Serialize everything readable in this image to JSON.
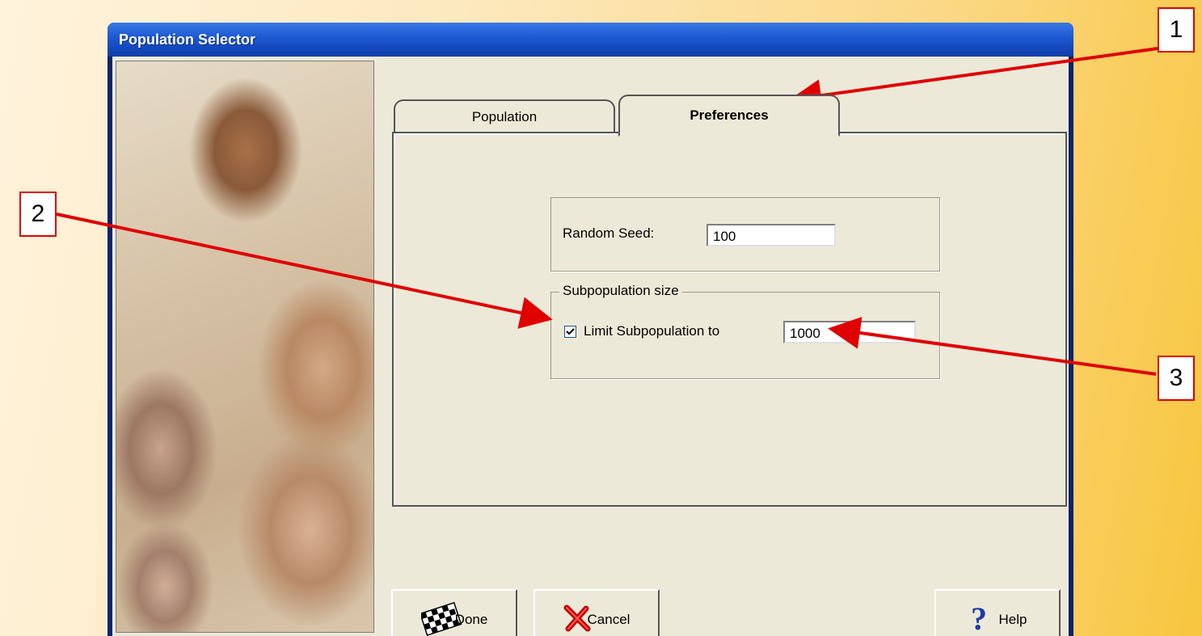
{
  "window": {
    "title": "Population Selector"
  },
  "tabs": [
    {
      "label": "Population",
      "selected": false
    },
    {
      "label": "Preferences",
      "selected": true
    }
  ],
  "seed": {
    "label": "Random Seed:",
    "value": "100"
  },
  "subpopulation": {
    "group_title": "Subpopulation size",
    "checkbox_label": "Limit Subpopulation to",
    "checked": true,
    "value": "1000"
  },
  "buttons": {
    "done": "Done",
    "cancel": "Cancel",
    "help": "Help"
  },
  "callouts": [
    "1",
    "2",
    "3"
  ],
  "colors": {
    "callout_red": "#e00000",
    "titlebar_blue": "#1f5bd4",
    "dialog_bg": "#ece9d8"
  }
}
